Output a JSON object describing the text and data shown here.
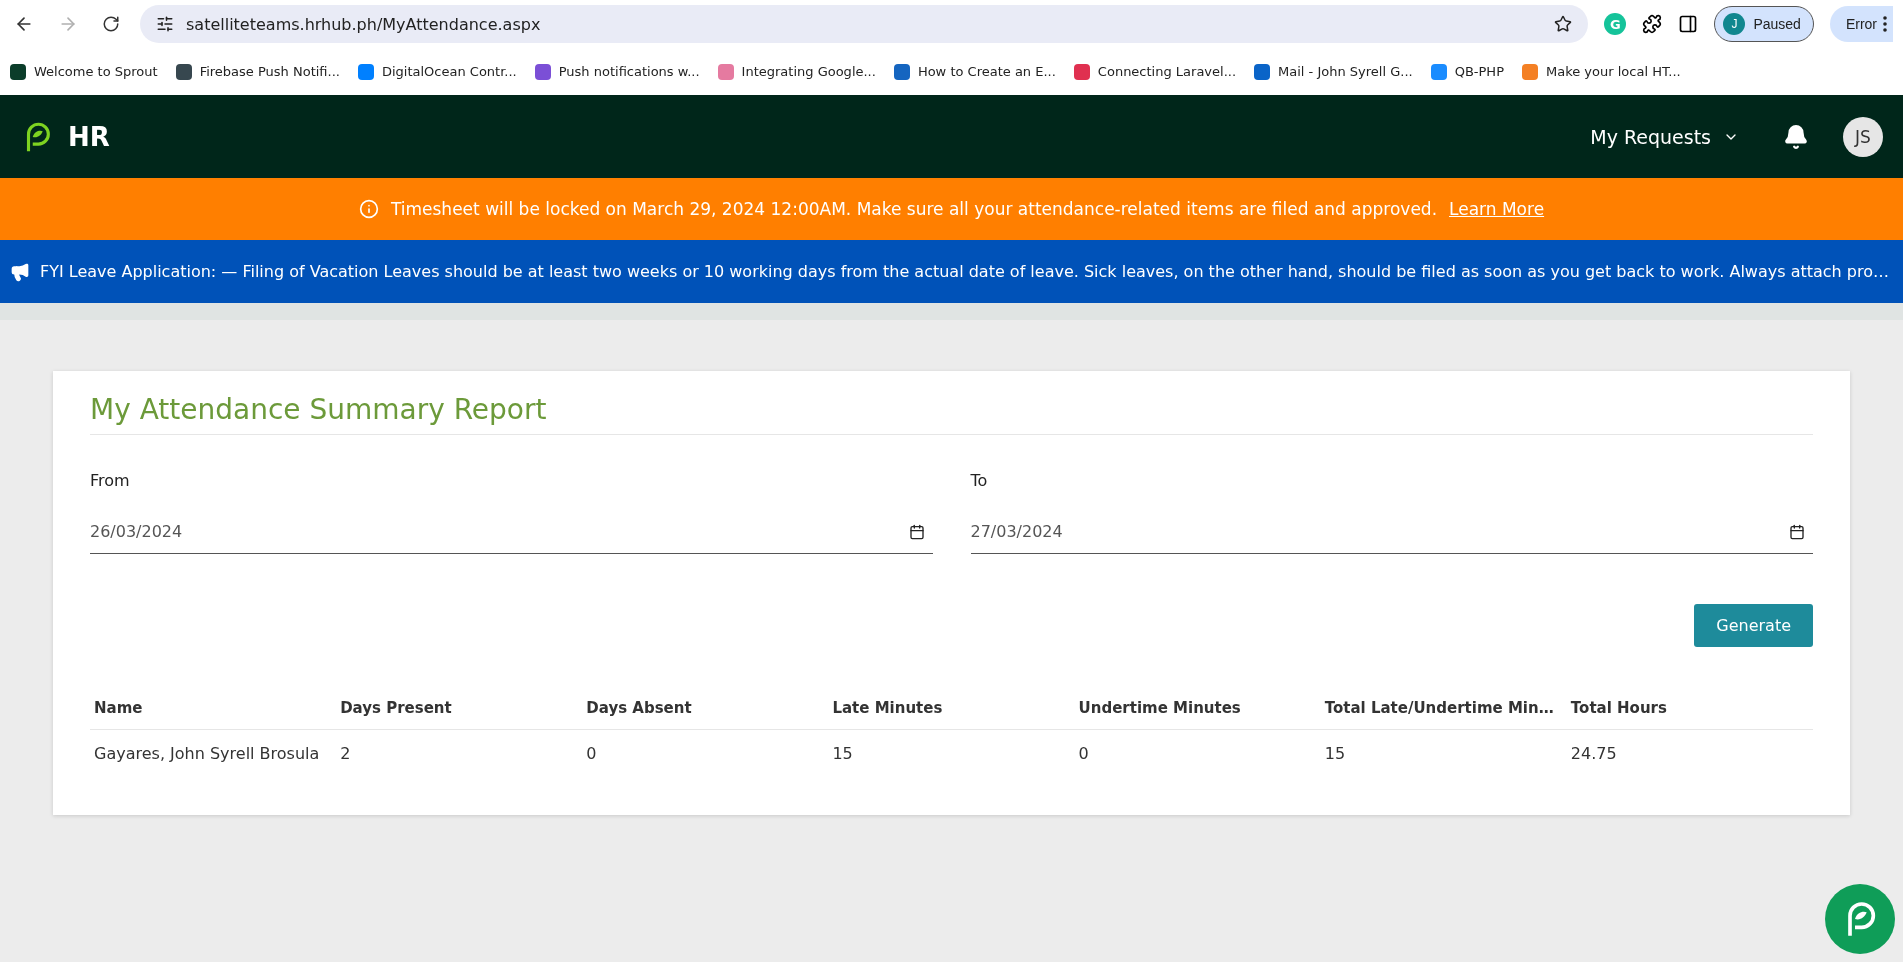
{
  "browser": {
    "forward_disabled": true,
    "url": "satelliteteams.hrhub.ph/MyAttendance.aspx",
    "extension_letter": "G",
    "profile_initial": "J",
    "profile_status": "Paused",
    "error_label": "Error",
    "bookmarks": [
      "Welcome to Sprout",
      "Firebase Push Notifi...",
      "DigitalOcean Contr...",
      "Push notifications w...",
      "Integrating Google...",
      "How to Create an E...",
      "Connecting Laravel...",
      "Mail - John Syrell G...",
      "QB-PHP",
      "Make your local HT..."
    ]
  },
  "header": {
    "brand": "HR",
    "menu_label": "My Requests",
    "avatar_initials": "JS"
  },
  "notice": {
    "text": "Timesheet will be locked on March 29, 2024 12:00AM. Make sure all your attendance-related items are filed and approved.",
    "link": "Learn More"
  },
  "announcement": {
    "text": "FYI Leave Application: — Filing of Vacation Leaves should be at least two weeks or 10 working days from the actual date of leave. Sick leaves, on the other hand, should be filed as soon as you get back to work. Always attach pro…"
  },
  "report": {
    "title": "My Attendance Summary Report",
    "fields": [
      {
        "label": "From",
        "value": "26/03/2024"
      },
      {
        "label": "To",
        "value": "27/03/2024"
      }
    ],
    "button": "Generate",
    "table": {
      "columns": [
        "Name",
        "Days Present",
        "Days Absent",
        "Late Minutes",
        "Undertime Minutes",
        "Total Late/Undertime Min…",
        "Total Hours"
      ],
      "rows": [
        [
          "Gayares, John Syrell Brosula",
          "2",
          "0",
          "15",
          "0",
          "15",
          "24.75"
        ]
      ]
    }
  }
}
